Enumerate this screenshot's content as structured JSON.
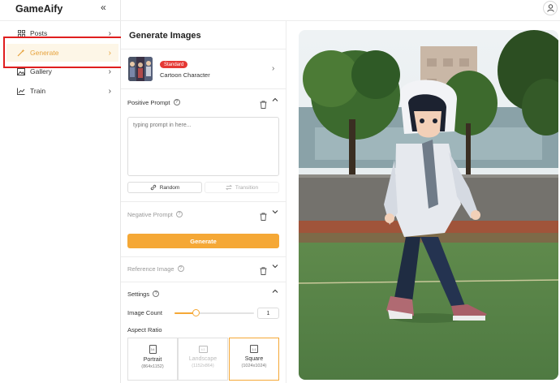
{
  "app": {
    "title": "GameAify"
  },
  "sidebar": {
    "items": [
      {
        "label": "Posts",
        "icon": "grid-icon",
        "active": false
      },
      {
        "label": "Generate",
        "icon": "magic-wand-icon",
        "active": true
      },
      {
        "label": "Gallery",
        "icon": "image-icon",
        "active": false
      },
      {
        "label": "Train",
        "icon": "chart-line-icon",
        "active": false
      }
    ]
  },
  "panel": {
    "title": "Generate Images",
    "model": {
      "badge": "Standard",
      "name": "Cartoon Character"
    },
    "positive_prompt": {
      "label": "Positive Prompt",
      "placeholder": "typing prompt in here...",
      "random_label": "Random",
      "transition_label": "Transition"
    },
    "negative_prompt": {
      "label": "Negative Prompt"
    },
    "generate_label": "Generate",
    "reference_image": {
      "label": "Reference Image"
    },
    "settings": {
      "label": "Settings",
      "image_count_label": "Image Count",
      "image_count_value": "1",
      "slider_fraction": 0.27,
      "aspect_ratio_label": "Aspect Ratio",
      "aspect_ratios": [
        {
          "icon_text": "3:4",
          "name": "Portrait",
          "size": "(864x1152)",
          "state": "normal"
        },
        {
          "icon_text": "4:3",
          "name": "Landscape",
          "size": "(1152x864)",
          "state": "disabled"
        },
        {
          "icon_text": "1:1",
          "name": "Square",
          "size": "(1024x1024)",
          "state": "selected"
        }
      ]
    }
  },
  "colors": {
    "accent": "#f5a836",
    "badge": "#e53935",
    "highlight": "#e01e1e"
  }
}
